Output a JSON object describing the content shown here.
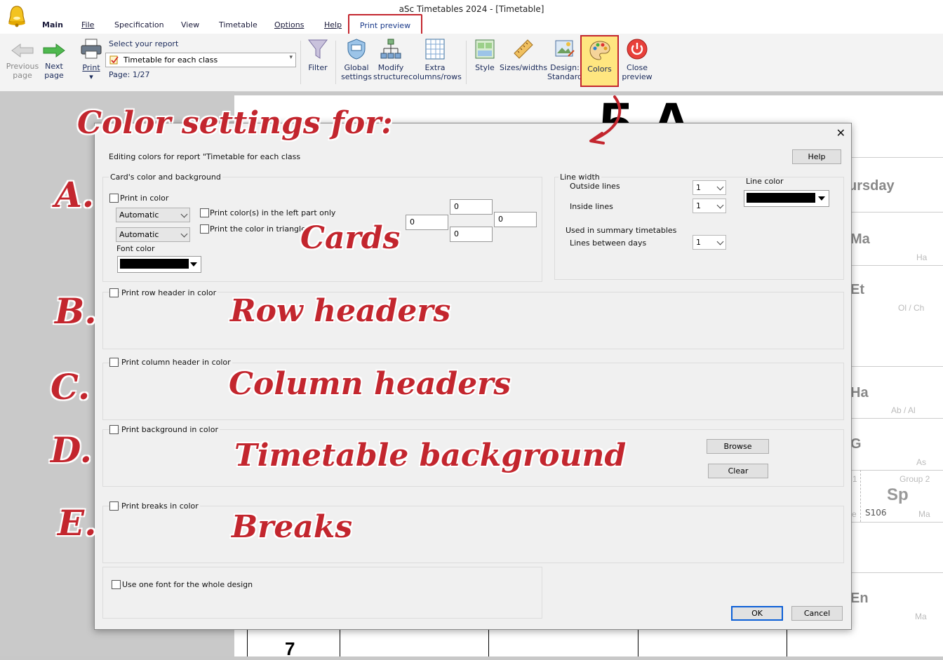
{
  "app_title": "aSc Timetables 2024  - [Timetable]",
  "menu_tabs": [
    {
      "label": "Main"
    },
    {
      "label": "File"
    },
    {
      "label": "Specification"
    },
    {
      "label": "View"
    },
    {
      "label": "Timetable"
    },
    {
      "label": "Options"
    },
    {
      "label": "Help"
    }
  ],
  "active_tab": "Print preview",
  "ribbon": {
    "previous_page": [
      "Previous",
      "page"
    ],
    "next_page": [
      "Next",
      "page"
    ],
    "print": "Print",
    "select_report_label": "Select your report",
    "selected_report": "Timetable for each class",
    "page_indicator": "Page: 1/27",
    "filter": "Filter",
    "global_settings": [
      "Global",
      "settings"
    ],
    "modify_structure": [
      "Modify",
      "structure"
    ],
    "extra_columns": [
      "Extra",
      "columns/rows"
    ],
    "style": "Style",
    "sizes_widths": "Sizes/widths",
    "design": [
      "Design:",
      "Standard"
    ],
    "colors": "Colors",
    "close_preview": [
      "Close",
      "preview"
    ]
  },
  "background_timetable": {
    "class_title": "5.A",
    "day_header": "ursday",
    "cells": [
      {
        "subject": "Ma",
        "teacher": "Ha"
      },
      {
        "subject": "Et",
        "teacher": "Ol / Ch"
      },
      {
        "subject": "Ha",
        "teacher": "Ab / Al"
      },
      {
        "subject": "G",
        "teacher": "As"
      },
      {
        "subject": "Sp",
        "teacher": "Ma",
        "group": "Group 2",
        "room": "S106",
        "left_group_digit": "1",
        "left_room_fragment": "e"
      },
      {
        "subject": "En",
        "teacher": "Ma"
      }
    ],
    "period_number": "7"
  },
  "dialog": {
    "editing_label": "Editing colors for report \"Timetable for each class",
    "help_button": "Help",
    "card_group_title": "Card's color and background",
    "print_in_color": "Print in color",
    "automatic_1": "Automatic",
    "automatic_2": "Automatic",
    "font_color_label": "Font color",
    "print_left_only": "Print color(s) in the left part only",
    "print_triangle": "Print the color in triangle",
    "offsets": {
      "top": "0",
      "left": "0",
      "right": "0",
      "bottom": "0"
    },
    "line_width_title": "Line width",
    "outside_lines": "Outside lines",
    "outside_lines_value": "1",
    "inside_lines": "Inside lines",
    "inside_lines_value": "1",
    "line_color_label": "Line color",
    "used_in_summary": "Used in summary timetables",
    "lines_between_days": "Lines between days",
    "lines_between_days_value": "1",
    "print_row_header": "Print row header in color",
    "print_column_header": "Print column header in color",
    "print_background": "Print background in color",
    "browse_button": "Browse",
    "clear_button": "Clear",
    "print_breaks": "Print breaks in color",
    "use_one_font": "Use one font for the whole design",
    "ok_button": "OK",
    "cancel_button": "Cancel"
  },
  "annotations": {
    "title": "Color settings for:",
    "letter_a": "A.",
    "letter_b": "B.",
    "letter_c": "C.",
    "letter_d": "D.",
    "letter_e": "E.",
    "cards": "Cards",
    "row_headers": "Row headers",
    "column_headers": "Column headers",
    "timetable_background": "Timetable background",
    "breaks": "Breaks"
  },
  "colors": {
    "accent_red": "#c3262e",
    "colors_button_bg": "#ffe680",
    "dialog_bg": "#f0f0f0"
  }
}
